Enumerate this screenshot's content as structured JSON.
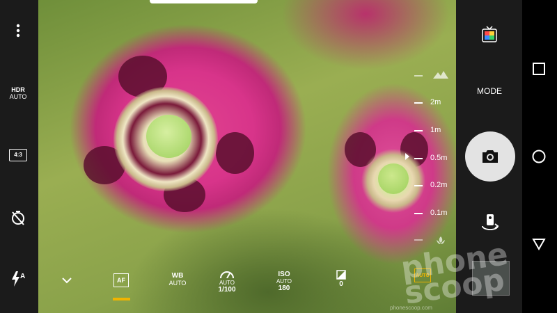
{
  "left_bar": {
    "hdr_label": "HDR",
    "hdr_value": "AUTO",
    "aspect_label": "4:3"
  },
  "scale": {
    "labels": [
      "2m",
      "1m",
      "0.5m",
      "0.2m",
      "0.1m"
    ]
  },
  "bottom": {
    "af_label": "AF",
    "wb_label": "WB",
    "wb_value": "AUTO",
    "shutter_mode": "AUTO",
    "shutter_value": "1/100",
    "iso_label": "ISO",
    "iso_mode": "AUTO",
    "iso_value": "180",
    "ev_value": "0",
    "auto_box": "AUTO"
  },
  "right_bar": {
    "mode_label": "MODE"
  },
  "watermark": {
    "text": "phone scoop",
    "small": "phonescoop.com"
  },
  "colors": {
    "accent": "#f0b400",
    "bar": "#1b1b1b"
  }
}
